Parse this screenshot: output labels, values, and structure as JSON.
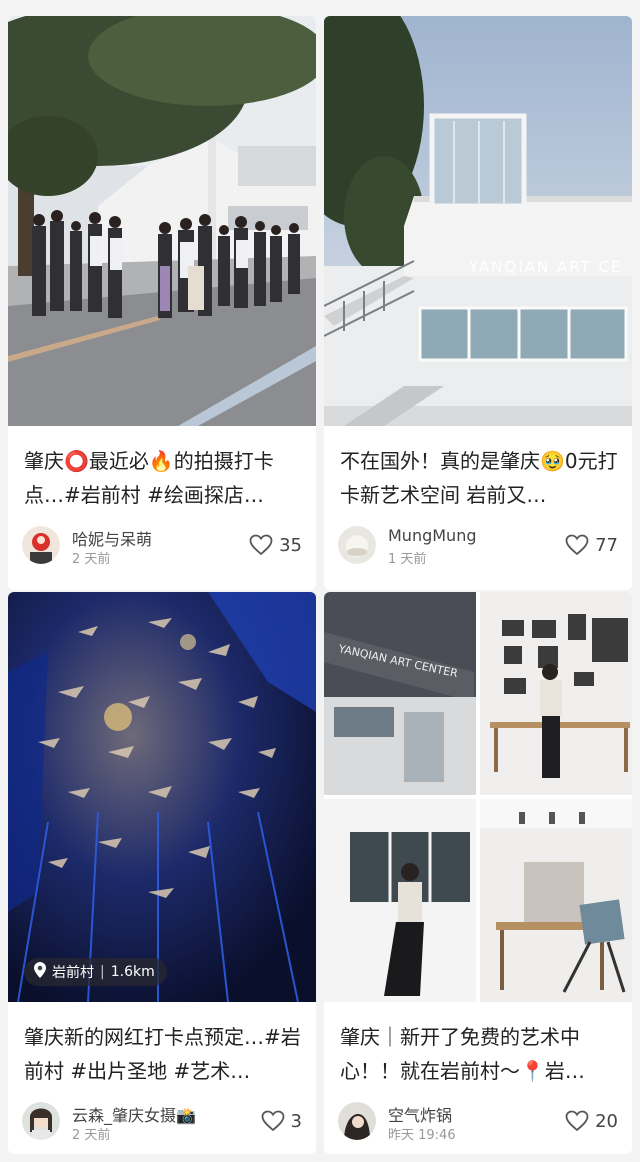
{
  "feed": {
    "cards": [
      {
        "title": "肇庆⭕最近必🔥的拍摄打卡点…#岩前村 #绘画探店…",
        "author": "哈妮与呆萌",
        "time": "2 天前",
        "likes": "35"
      },
      {
        "title": "不在国外！真的是肇庆🥹0元打卡新艺术空间 岩前又…",
        "author": "MungMung",
        "time": "1 天前",
        "likes": "77",
        "image_sign_text": "YANQIAN ART CE"
      },
      {
        "title": "肇庆新的网红打卡点预定…#岩前村 #出片圣地 #艺术…",
        "author": "云森_肇庆女摄📸",
        "time": "2 天前",
        "likes": "3",
        "location": {
          "name": "岩前村",
          "separator": "|",
          "distance": "1.6km"
        }
      },
      {
        "title": "肇庆｜新开了免费的艺术中心！！就在岩前村～📍岩…",
        "author": "空气炸锅",
        "time": "昨天 19:46",
        "likes": "20",
        "image_sign_text": "YANQIAN ART CENTER"
      }
    ]
  },
  "colors": {
    "background": "#f3f3f3",
    "card": "#ffffff",
    "heart_stroke": "#555555",
    "meta_gray": "#999999"
  },
  "icons": [
    "heart-icon",
    "location-pin-icon",
    "avatar"
  ]
}
